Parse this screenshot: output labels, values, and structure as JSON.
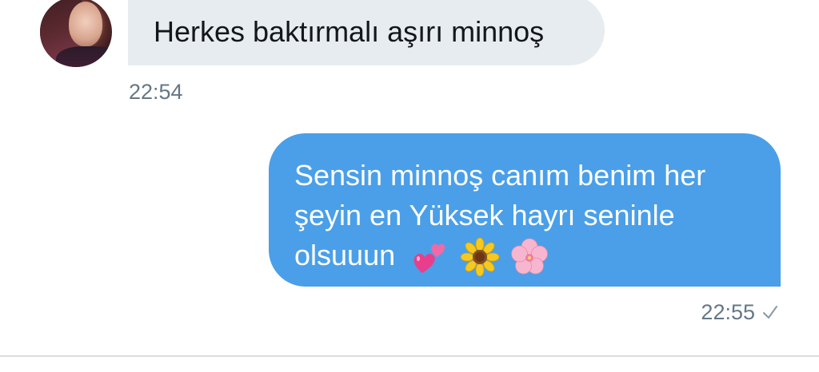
{
  "conversation": {
    "incoming": {
      "avatar_icon": "profile-photo",
      "text": "Herkes baktırmalı aşırı minnoş",
      "time": "22:54"
    },
    "outgoing": {
      "lines": [
        "Sensin minnoş canım benim her",
        "şeyin en Yüksek hayrı seninle",
        "olsuuun"
      ],
      "emojis": [
        "two-hearts-icon",
        "sunflower-icon",
        "cherry-blossom-icon"
      ],
      "time": "22:55",
      "status_icon": "checkmark-icon"
    }
  },
  "colors": {
    "incoming_bubble": "#e6ecf0",
    "outgoing_bubble": "#4a9fe8",
    "timestamp": "#657786"
  }
}
